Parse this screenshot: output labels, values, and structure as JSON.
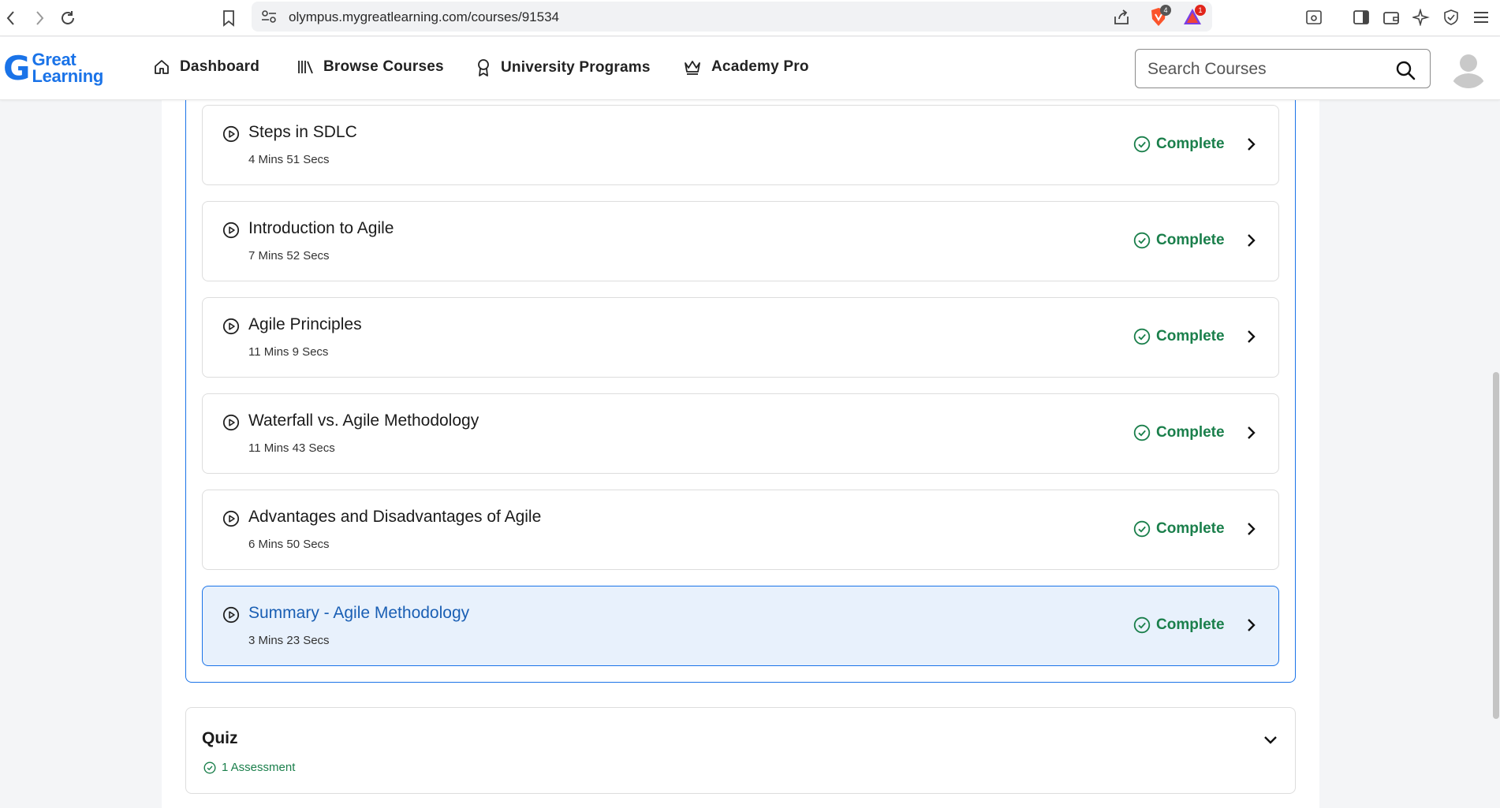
{
  "browser": {
    "url": "olympus.mygreatlearning.com/courses/91534",
    "brave_badge": "4",
    "rewards_badge": "1"
  },
  "header": {
    "logo_line1": "Great",
    "logo_line2": "Learning",
    "nav": [
      {
        "label": "Dashboard",
        "icon": "home-icon"
      },
      {
        "label": "Browse Courses",
        "icon": "library-icon"
      },
      {
        "label": "University Programs",
        "icon": "award-icon"
      },
      {
        "label": "Academy Pro",
        "icon": "crown-icon"
      }
    ],
    "search_placeholder": "Search Courses"
  },
  "lessons": [
    {
      "title": "Steps in SDLC",
      "duration": "4 Mins 51 Secs",
      "status": "Complete",
      "active": false
    },
    {
      "title": "Introduction to Agile",
      "duration": "7 Mins 52 Secs",
      "status": "Complete",
      "active": false
    },
    {
      "title": "Agile Principles",
      "duration": "11 Mins 9 Secs",
      "status": "Complete",
      "active": false
    },
    {
      "title": "Waterfall vs. Agile Methodology",
      "duration": "11 Mins 43 Secs",
      "status": "Complete",
      "active": false
    },
    {
      "title": "Advantages and Disadvantages of Agile",
      "duration": "6 Mins 50 Secs",
      "status": "Complete",
      "active": false
    },
    {
      "title": "Summary - Agile Methodology",
      "duration": "3 Mins 23 Secs",
      "status": "Complete",
      "active": true
    }
  ],
  "quiz": {
    "title": "Quiz",
    "assessment": "1 Assessment"
  },
  "colors": {
    "accent": "#1a73e8",
    "complete": "#1a7f4b",
    "active_bg": "#e8f1fc"
  }
}
